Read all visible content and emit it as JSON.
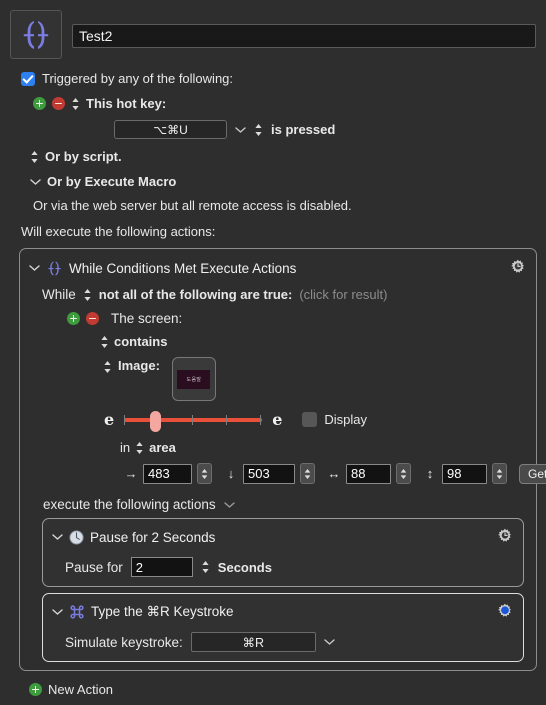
{
  "macro": {
    "icon_name": "braces-macro-icon",
    "name_value": "Test2"
  },
  "trigger_section": {
    "checkbox_label": "Triggered by any of the following:",
    "checked": true,
    "hotkey": {
      "label": "This hot key:",
      "value": "⌥⌘U",
      "condition": "is pressed"
    },
    "script_label": "Or by script.",
    "execute_macro_label": "Or by Execute Macro",
    "web_server_note": "Or via the web server but all remote access is disabled."
  },
  "will_execute_label": "Will execute the following actions:",
  "while_action": {
    "title": "While Conditions Met Execute Actions",
    "while_label": "While",
    "condition_mode": "not all of the following are true:",
    "result_hint": "(click for result)",
    "condition": {
      "target_label": "The screen:",
      "operator": "contains",
      "image_label": "Image:",
      "thumbnail_text": "도움말",
      "fuzz_left_glyph": "e",
      "fuzz_right_glyph": "e",
      "display_label": "Display",
      "display_checked": false,
      "area_prefix": "in",
      "area_label": "area",
      "coords": [
        {
          "icon": "arrow-right-icon",
          "glyph": "→",
          "value": "483"
        },
        {
          "icon": "arrow-down-icon",
          "glyph": "↓",
          "value": "503"
        },
        {
          "icon": "arrow-width-icon",
          "glyph": "↔",
          "value": "88"
        },
        {
          "icon": "arrow-height-icon",
          "glyph": "↕",
          "value": "98"
        }
      ],
      "get_button": "Get"
    },
    "execute_following_label": "execute the following actions",
    "sub_actions": [
      {
        "icon_name": "clock-icon",
        "title": "Pause for 2 Seconds",
        "field_label": "Pause for",
        "value": "2",
        "unit": "Seconds",
        "gear": "gear-clock-icon"
      },
      {
        "icon_name": "command-icon",
        "title": "Type the ⌘R Keystroke",
        "field_label": "Simulate keystroke:",
        "value": "⌘R",
        "gear": "gear-blue-icon"
      }
    ]
  },
  "new_action_label": "New Action",
  "colors": {
    "window_bg": "#2e2e2e",
    "accent_blue": "#2e7ff0",
    "add_green": "#3e9b3e",
    "remove_red": "#c23b32",
    "slider_red": "#e8503a",
    "icon_purple": "#7b7ce0"
  }
}
